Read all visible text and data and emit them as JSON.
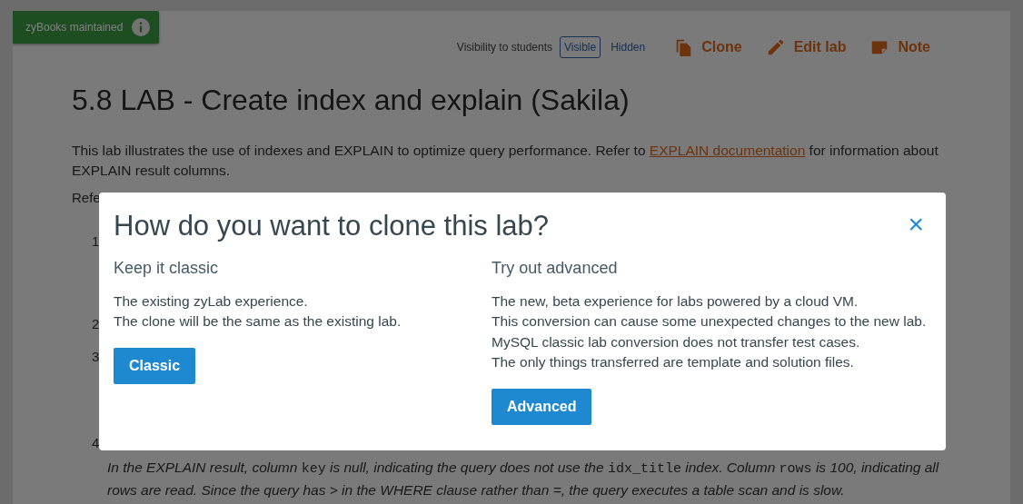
{
  "badge": {
    "label": "zyBooks maintained"
  },
  "visibility": {
    "label": "Visibility to students",
    "options": [
      {
        "label": "Visible",
        "selected": true
      },
      {
        "label": "Hidden",
        "selected": false
      }
    ]
  },
  "actions": [
    {
      "label": "Clone",
      "kind": "clone"
    },
    {
      "label": "Edit lab",
      "kind": "edit"
    },
    {
      "label": "Note",
      "kind": "note"
    }
  ],
  "title": "5.8 LAB - Create index and explain (Sakila)",
  "intro": {
    "before": "This lab illustrates the use of indexes and EXPLAIN to optimize query performance. Refer to ",
    "link": "EXPLAIN documentation",
    "after": " for information about EXPLAIN result columns."
  },
  "partial_text": "Refe",
  "steps": [
    {
      "number": "1"
    },
    {
      "number": "2"
    },
    {
      "number": "3"
    },
    {
      "number": "4"
    }
  ],
  "note": [
    {
      "text": "In the EXPLAIN result, column ",
      "code": false
    },
    {
      "text": "key",
      "code": true
    },
    {
      "text": " is null, indicating the query does not use the ",
      "code": false
    },
    {
      "text": "idx_title",
      "code": true
    },
    {
      "text": " index. Column ",
      "code": false
    },
    {
      "text": "rows",
      "code": true
    },
    {
      "text": " is 100, indicating all rows are read. Since the query has > in the WHERE clause rather than =, the query executes a table scan and is slow.",
      "code": false
    }
  ],
  "dialog": {
    "title": "How do you want to clone this lab?",
    "close": "×",
    "options": [
      {
        "heading": "Keep it classic",
        "lines": [
          "The existing zyLab experience.",
          "The clone will be the same as the existing lab."
        ],
        "button": "Classic"
      },
      {
        "heading": "Try out advanced",
        "lines": [
          "The new, beta experience for labs powered by a cloud VM.",
          "This conversion can cause some unexpected changes to the new lab.",
          "MySQL classic lab conversion does not transfer test cases.",
          "The only things transferred are template and solution files."
        ],
        "button": "Advanced"
      }
    ]
  }
}
